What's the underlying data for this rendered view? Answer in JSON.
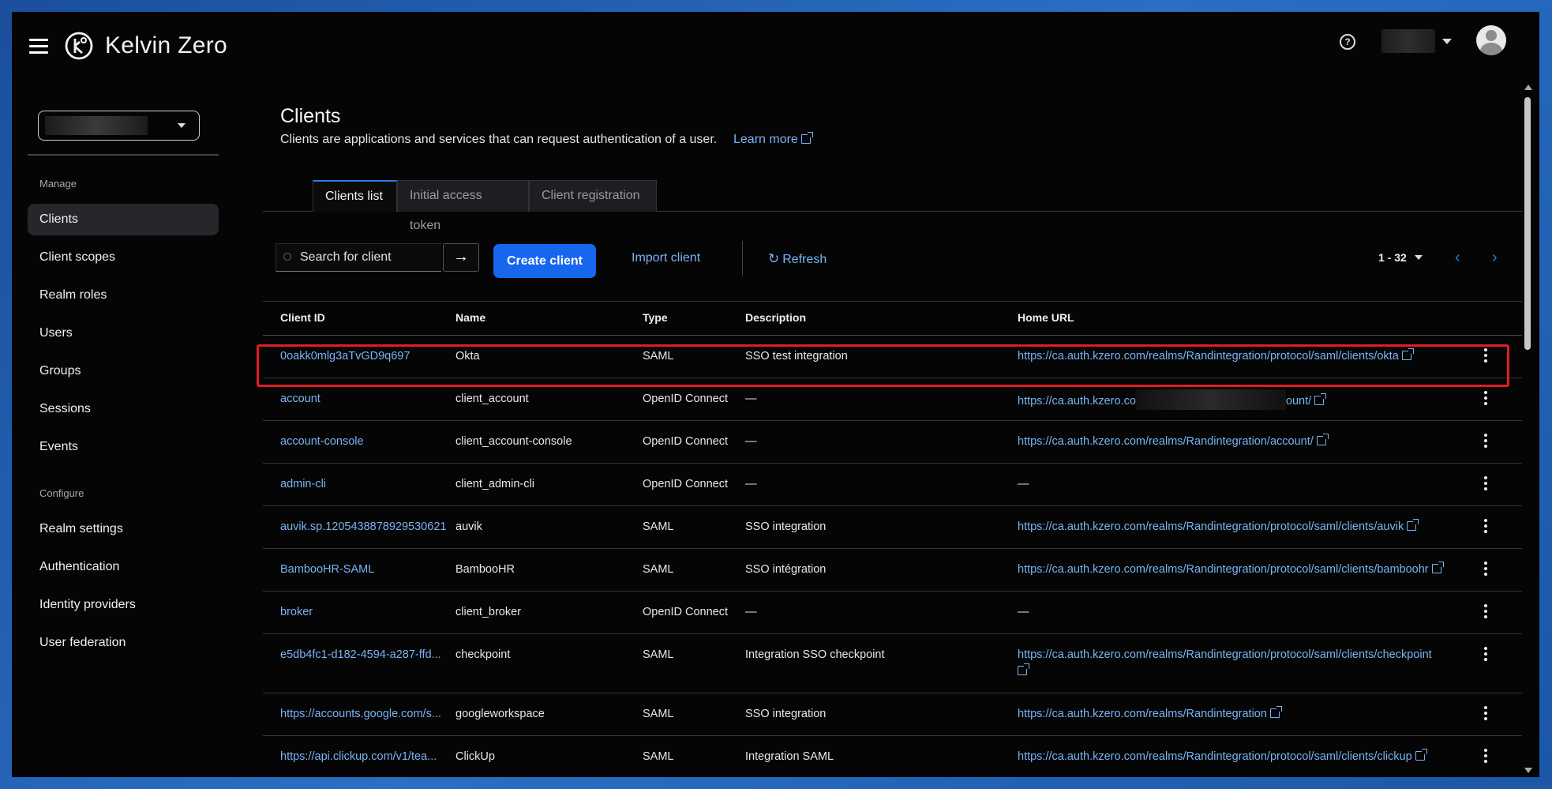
{
  "header": {
    "brand": "Kelvin Zero",
    "help_icon": "help-circle-icon"
  },
  "sidebar": {
    "manage_label": "Manage",
    "manage_items": [
      "Clients",
      "Client scopes",
      "Realm roles",
      "Users",
      "Groups",
      "Sessions",
      "Events"
    ],
    "configure_label": "Configure",
    "configure_items": [
      "Realm settings",
      "Authentication",
      "Identity providers",
      "User federation"
    ],
    "active": "Clients"
  },
  "page": {
    "title": "Clients",
    "description": "Clients are applications and services that can request authentication of a user.",
    "learn_more": "Learn more"
  },
  "tabs": [
    "Clients list",
    "Initial access token",
    "Client registration"
  ],
  "toolbar": {
    "search_placeholder": "Search for client",
    "create_label": "Create client",
    "import_label": "Import client",
    "refresh_label": "Refresh",
    "pagination": "1 - 32"
  },
  "table": {
    "headers": [
      "Client ID",
      "Name",
      "Type",
      "Description",
      "Home URL"
    ],
    "rows": [
      {
        "client_id": "0oakk0mlg3aTvGD9q697",
        "name": "Okta",
        "type": "SAML",
        "description": "SSO test integration",
        "home_url": "https://ca.auth.kzero.com/realms/Randintegration/protocol/saml/clients/okta"
      },
      {
        "client_id": "account",
        "name": "client_account",
        "type": "OpenID Connect",
        "description": "—",
        "home_url_prefix": "https://ca.auth.kzero.co",
        "home_url_suffix": "ount/"
      },
      {
        "client_id": "account-console",
        "name": "client_account-console",
        "type": "OpenID Connect",
        "description": "—",
        "home_url": "https://ca.auth.kzero.com/realms/Randintegration/account/"
      },
      {
        "client_id": "admin-cli",
        "name": "client_admin-cli",
        "type": "OpenID Connect",
        "description": "—",
        "home_url": "—"
      },
      {
        "client_id": "auvik.sp.1205438878929530621",
        "name": "auvik",
        "type": "SAML",
        "description": "SSO integration",
        "home_url": "https://ca.auth.kzero.com/realms/Randintegration/protocol/saml/clients/auvik"
      },
      {
        "client_id": "BambooHR-SAML",
        "name": "BambooHR",
        "type": "SAML",
        "description": "SSO intégration",
        "home_url": "https://ca.auth.kzero.com/realms/Randintegration/protocol/saml/clients/bamboohr"
      },
      {
        "client_id": "broker",
        "name": "client_broker",
        "type": "OpenID Connect",
        "description": "—",
        "home_url": "—"
      },
      {
        "client_id": "e5db4fc1-d182-4594-a287-ffd...",
        "name": "checkpoint",
        "type": "SAML",
        "description": "Integration SSO checkpoint",
        "home_url": "https://ca.auth.kzero.com/realms/Randintegration/protocol/saml/clients/checkpoint"
      },
      {
        "client_id": "https://accounts.google.com/s...",
        "name": "googleworkspace",
        "type": "SAML",
        "description": "SSO integration",
        "home_url": "https://ca.auth.kzero.com/realms/Randintegration"
      },
      {
        "client_id": "https://api.clickup.com/v1/tea...",
        "name": "ClickUp",
        "type": "SAML",
        "description": "Integration SAML",
        "home_url": "https://ca.auth.kzero.com/realms/Randintegration/protocol/saml/clients/clickup"
      }
    ]
  },
  "colors": {
    "accent": "#1666ee",
    "link": "#79b4f3",
    "highlight": "#e01d24"
  }
}
